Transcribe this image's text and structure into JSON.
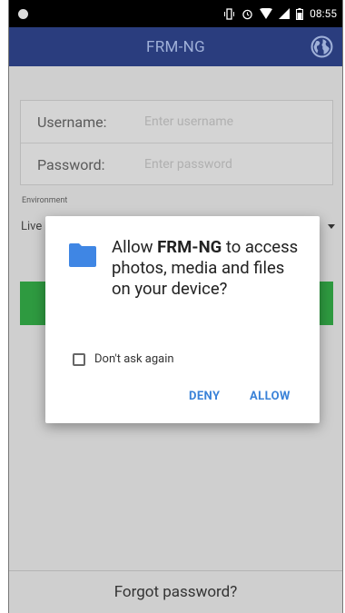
{
  "status_bar": {
    "time": "08:55"
  },
  "app_bar": {
    "title": "FRM-NG"
  },
  "login_form": {
    "username_label": "Username:",
    "username_placeholder": "Enter username",
    "password_label": "Password:",
    "password_placeholder": "Enter password",
    "environment_label": "Environment",
    "environment_value": "Live"
  },
  "footer": {
    "forgot_password": "Forgot password?"
  },
  "permission_dialog": {
    "message_prefix": "Allow ",
    "app_name": "FRM-NG",
    "message_suffix": " to access photos, media and files on your device?",
    "checkbox_label": "Don't ask again",
    "deny_label": "DENY",
    "allow_label": "ALLOW",
    "accent_color": "#3a82d8"
  },
  "colors": {
    "app_bar": "#2a3d7e",
    "login_button": "#2e9a40"
  }
}
